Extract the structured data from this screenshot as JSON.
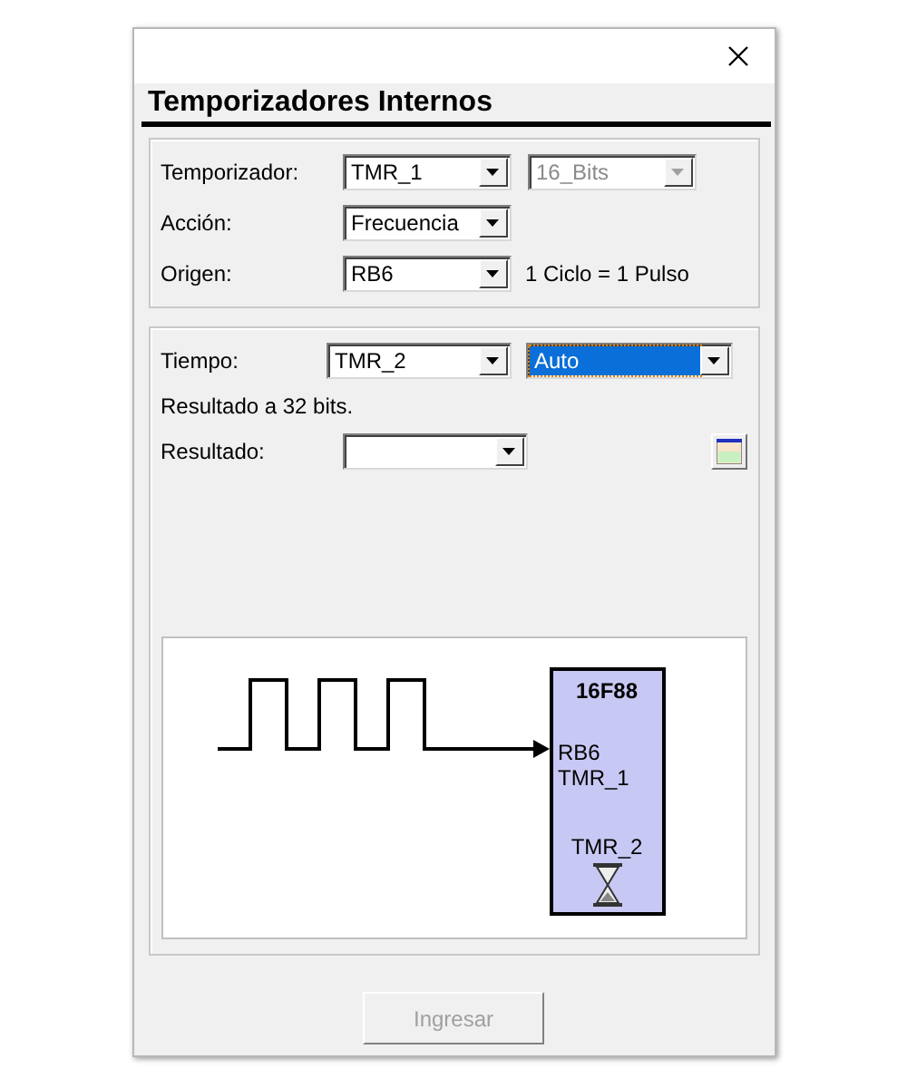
{
  "heading": "Temporizadores Internos",
  "settings": [
    {
      "label": "Temporizador:",
      "value": "TMR_1",
      "extra": {
        "value": "16_Bits",
        "disabled": true
      }
    },
    {
      "label": "Acción:",
      "value": "Frecuencia"
    },
    {
      "label": "Origen:",
      "value": "RB6",
      "note": "1 Ciclo = 1 Pulso"
    }
  ],
  "timing": {
    "label": "Tiempo:",
    "combos": [
      {
        "value": "TMR_2",
        "focused": false
      },
      {
        "value": "Auto",
        "focused": true
      }
    ],
    "info": "Resultado a 32 bits.",
    "result_label": "Resultado:"
  },
  "diagram": {
    "chip": "16F88",
    "pins": [
      "RB6",
      "TMR_1"
    ],
    "timer": "TMR_2"
  },
  "submit": {
    "label": "Ingresar",
    "disabled": true
  }
}
